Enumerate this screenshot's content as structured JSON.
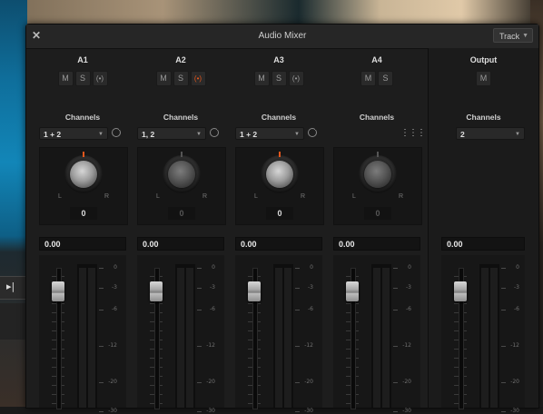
{
  "background": {
    "timeline_marker_icon": "jump-to-end-icon"
  },
  "window": {
    "title": "Audio Mixer",
    "close_icon": "close-icon",
    "mode_select": {
      "value": "Track"
    }
  },
  "strips": [
    {
      "name": "A1",
      "buttons": {
        "mute": "M",
        "solo": "S",
        "record": "(•)"
      },
      "record_active": false,
      "channels_label": "Channels",
      "channels_value": "1 + 2",
      "pan": {
        "left": "L",
        "right": "R",
        "value": "0",
        "enabled": true
      },
      "volume": "0.00"
    },
    {
      "name": "A2",
      "buttons": {
        "mute": "M",
        "solo": "S",
        "record": "(•)"
      },
      "record_active": true,
      "channels_label": "Channels",
      "channels_value": "1, 2",
      "pan": {
        "left": "L",
        "right": "R",
        "value": "0",
        "enabled": false
      },
      "volume": "0.00"
    },
    {
      "name": "A3",
      "buttons": {
        "mute": "M",
        "solo": "S",
        "record": "(•)"
      },
      "record_active": false,
      "channels_label": "Channels",
      "channels_value": "1 + 2",
      "pan": {
        "left": "L",
        "right": "R",
        "value": "0",
        "enabled": true
      },
      "volume": "0.00"
    },
    {
      "name": "A4",
      "buttons": {
        "mute": "M",
        "solo": "S"
      },
      "channels_label": "Channels",
      "channels_icon": "grid-icon",
      "pan": {
        "left": "L",
        "right": "R",
        "value": "0",
        "enabled": false
      },
      "volume": "0.00"
    }
  ],
  "output": {
    "name": "Output",
    "buttons": {
      "mute": "M"
    },
    "channels_label": "Channels",
    "channels_value": "2",
    "volume": "0.00"
  },
  "meter_scale": [
    "0",
    "-3",
    "-6",
    "-12",
    "-20",
    "-30"
  ],
  "colors": {
    "accent_record": "#e2561c",
    "panel": "#1d1d1d"
  }
}
